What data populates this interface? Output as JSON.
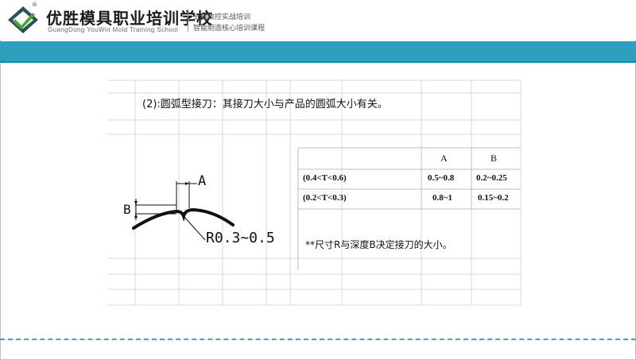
{
  "header": {
    "school_name": "优胜模具职业培训学校",
    "school_name_en": "GuangDong YouWin Mold Training School",
    "registered_mark": "®",
    "tagline_1": "五轴数控实战培训",
    "tagline_2": "智能制造核心培训课程"
  },
  "content": {
    "heading": "(2):圆弧型接刀：其接刀大小与产品的圆弧大小有关。",
    "note": "**尺寸R与深度B决定接刀的大小。"
  },
  "diagram": {
    "label_a": "A",
    "label_b": "B",
    "label_r": "R0.3~0.5"
  },
  "table": {
    "columns": [
      "",
      "A",
      "B"
    ],
    "rows": [
      {
        "condition": "(0.4<T<0.6)",
        "a": "0.5~0.8",
        "b": "0.2~0.25"
      },
      {
        "condition": "(0.2<T<0.3)",
        "a": "0.8~1",
        "b": "0.15~0.2"
      }
    ]
  },
  "colors": {
    "teal_band": "#2e9fbf",
    "logo_green": "#4aa832",
    "logo_dark": "#2f4f5f"
  }
}
